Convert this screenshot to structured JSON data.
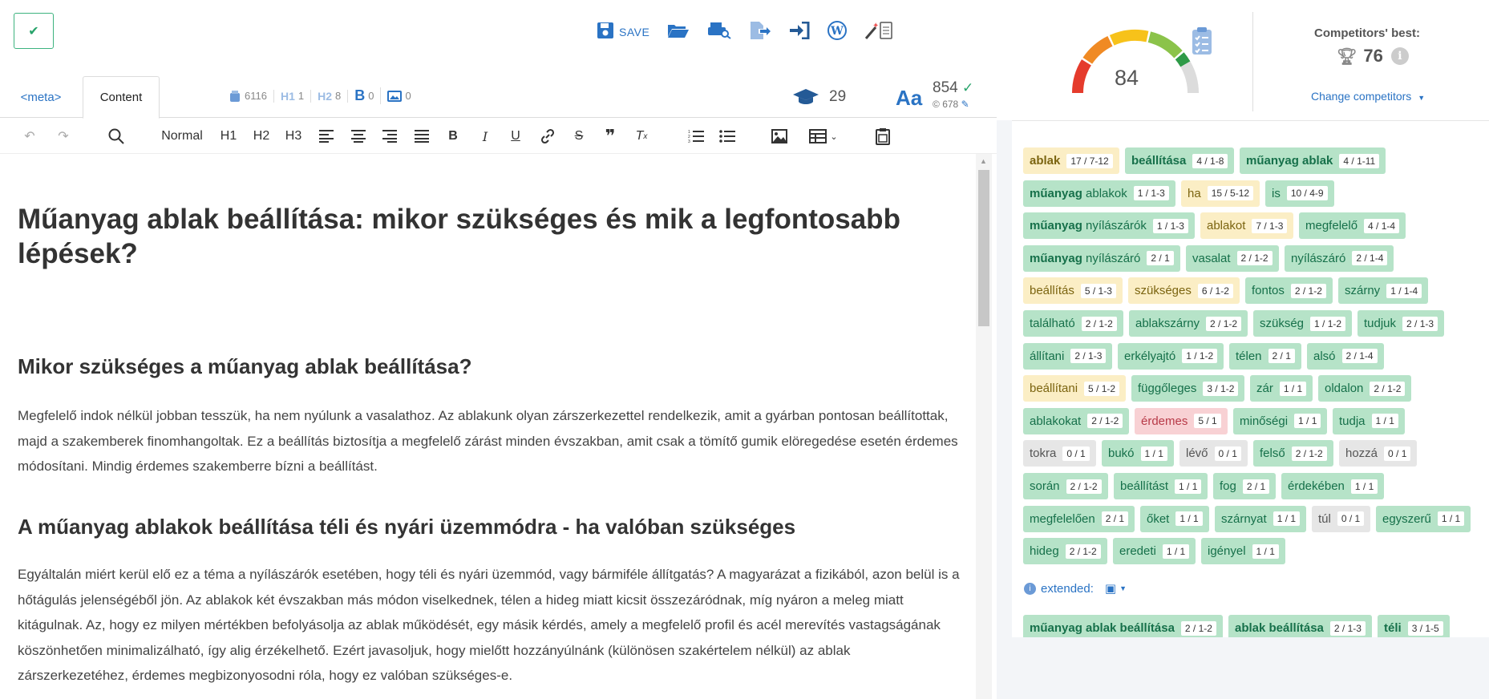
{
  "editor": {
    "save_label": "SAVE",
    "tabs": [
      {
        "label": "<meta>"
      },
      {
        "label": "Content"
      }
    ],
    "stats": [
      {
        "icon": "bucket-icon",
        "value": "6116"
      },
      {
        "icon": "h1-icon",
        "label": "H1",
        "value": "1"
      },
      {
        "icon": "h2-icon",
        "label": "H2",
        "value": "8"
      },
      {
        "icon": "bold-icon",
        "label": "B",
        "value": "0"
      },
      {
        "icon": "image-icon",
        "value": "0"
      }
    ],
    "readability": "29",
    "word_count": "854",
    "word_count_sub": "678",
    "toolbar": {
      "style_normal": "Normal",
      "h1": "H1",
      "h2": "H2",
      "h3": "H3"
    },
    "document": {
      "title": "Műanyag ablak beállítása: mikor szükséges és mik a legfontosabb lépések?",
      "h2_1": "Mikor szükséges a műanyag ablak beállítása?",
      "p1": "Megfelelő indok nélkül jobban tesszük, ha nem nyúlunk a vasalathoz. Az ablakunk olyan zárszerkezettel rendelkezik, amit a gyárban pontosan beállítottak, majd a szakemberek finomhangoltak. Ez a beállítás biztosítja a megfelelő zárást minden évszakban, amit csak a tömítő gumik elöregedése esetén érdemes módosítani. Mindig érdemes szakemberre bízni a beállítást.",
      "h2_2": "A műanyag ablakok beállítása téli és nyári üzemmódra - ha valóban szükséges",
      "p2": "Egyáltalán miért kerül elő ez a téma a nyílászárók esetében, hogy téli és nyári üzemmód, vagy bármiféle állítgatás? A magyarázat a fizikából, azon belül is a hőtágulás jelenségéből jön. Az ablakok két évszakban más módon viselkednek, télen a hideg miatt kicsit összezáródnak, míg nyáron a meleg miatt kitágulnak. Az, hogy ez milyen mértékben befolyásolja az ablak működését, egy másik kérdés, amely a megfelelő profil és acél merevítés vastagságának köszönhetően minimalizálható, így alig érzékelhető. Ezért javasoljuk, hogy mielőtt hozzányúlnánk (különösen szakértelem nélkül) az ablak zárszerkezetéhez, érdemes megbizonyosodni róla, hogy ez valóban szükséges-e."
    }
  },
  "panel": {
    "score": "84",
    "gauge_level": 0.84,
    "competitors_title": "Competitors' best:",
    "competitors_value": "76",
    "change_competitors": "Change competitors",
    "extended_label": "extended:",
    "colors": {
      "green": "#b6e3c8",
      "yellow": "#fbeec5",
      "red": "#f8d1d4",
      "neutral": "#e6e6e6",
      "accent": "#2a73c4"
    },
    "keywords": [
      {
        "text": "ablak",
        "count": "17 / 7-12",
        "status": "yellow"
      },
      {
        "text": "beállítása",
        "count": "4 / 1-8",
        "status": "green"
      },
      {
        "text": "műanyag ablak",
        "count": "4 / 1-11",
        "status": "green"
      },
      {
        "text": "műanyag ablakok",
        "count": "1 / 1-3",
        "status": "green"
      },
      {
        "text": "ha",
        "count": "15 / 5-12",
        "status": "yellow"
      },
      {
        "text": "is",
        "count": "10 / 4-9",
        "status": "green"
      },
      {
        "text": "műanyag nyílászárók",
        "count": "1 / 1-3",
        "status": "green"
      },
      {
        "text": "ablakot",
        "count": "7 / 1-3",
        "status": "yellow"
      },
      {
        "text": "megfelelő",
        "count": "4 / 1-4",
        "status": "green"
      },
      {
        "text": "műanyag nyílászáró",
        "count": "2 / 1",
        "status": "green"
      },
      {
        "text": "vasalat",
        "count": "2 / 1-2",
        "status": "green"
      },
      {
        "text": "nyílászáró",
        "count": "2 / 1-4",
        "status": "green"
      },
      {
        "text": "beállítás",
        "count": "5 / 1-3",
        "status": "yellow"
      },
      {
        "text": "szükséges",
        "count": "6 / 1-2",
        "status": "yellow"
      },
      {
        "text": "fontos",
        "count": "2 / 1-2",
        "status": "green"
      },
      {
        "text": "szárny",
        "count": "1 / 1-4",
        "status": "green"
      },
      {
        "text": "található",
        "count": "2 / 1-2",
        "status": "green"
      },
      {
        "text": "ablakszárny",
        "count": "2 / 1-2",
        "status": "green"
      },
      {
        "text": "szükség",
        "count": "1 / 1-2",
        "status": "green"
      },
      {
        "text": "tudjuk",
        "count": "2 / 1-3",
        "status": "green"
      },
      {
        "text": "állítani",
        "count": "2 / 1-3",
        "status": "green"
      },
      {
        "text": "erkélyajtó",
        "count": "1 / 1-2",
        "status": "green"
      },
      {
        "text": "télen",
        "count": "2 / 1",
        "status": "green"
      },
      {
        "text": "alsó",
        "count": "2 / 1-4",
        "status": "green"
      },
      {
        "text": "beállítani",
        "count": "5 / 1-2",
        "status": "yellow"
      },
      {
        "text": "függőleges",
        "count": "3 / 1-2",
        "status": "green"
      },
      {
        "text": "zár",
        "count": "1 / 1",
        "status": "green"
      },
      {
        "text": "oldalon",
        "count": "2 / 1-2",
        "status": "green"
      },
      {
        "text": "ablakokat",
        "count": "2 / 1-2",
        "status": "green"
      },
      {
        "text": "érdemes",
        "count": "5 / 1",
        "status": "red"
      },
      {
        "text": "minőségi",
        "count": "1 / 1",
        "status": "green"
      },
      {
        "text": "tudja",
        "count": "1 / 1",
        "status": "green"
      },
      {
        "text": "tokra",
        "count": "0 / 1",
        "status": "neutral"
      },
      {
        "text": "bukó",
        "count": "1 / 1",
        "status": "green"
      },
      {
        "text": "lévő",
        "count": "0 / 1",
        "status": "neutral"
      },
      {
        "text": "felső",
        "count": "2 / 1-2",
        "status": "green"
      },
      {
        "text": "hozzá",
        "count": "0 / 1",
        "status": "neutral"
      },
      {
        "text": "során",
        "count": "2 / 1-2",
        "status": "green"
      },
      {
        "text": "beállítást",
        "count": "1 / 1",
        "status": "green"
      },
      {
        "text": "fog",
        "count": "2 / 1",
        "status": "green"
      },
      {
        "text": "érdekében",
        "count": "1 / 1",
        "status": "green"
      },
      {
        "text": "megfelelően",
        "count": "2 / 1",
        "status": "green"
      },
      {
        "text": "őket",
        "count": "1 / 1",
        "status": "green"
      },
      {
        "text": "szárnyat",
        "count": "1 / 1",
        "status": "green"
      },
      {
        "text": "túl",
        "count": "0 / 1",
        "status": "neutral"
      },
      {
        "text": "egyszerű",
        "count": "1 / 1",
        "status": "green"
      },
      {
        "text": "hideg",
        "count": "2 / 1-2",
        "status": "green"
      },
      {
        "text": "eredeti",
        "count": "1 / 1",
        "status": "green"
      },
      {
        "text": "igényel",
        "count": "1 / 1",
        "status": "green"
      }
    ],
    "extended_keywords": [
      {
        "text": "műanyag ablak beállítása",
        "count": "2 / 1-2",
        "status": "green"
      },
      {
        "text": "ablak beállítása",
        "count": "2 / 1-3",
        "status": "green"
      },
      {
        "text": "téli",
        "count": "3 / 1-5",
        "status": "green"
      }
    ]
  }
}
